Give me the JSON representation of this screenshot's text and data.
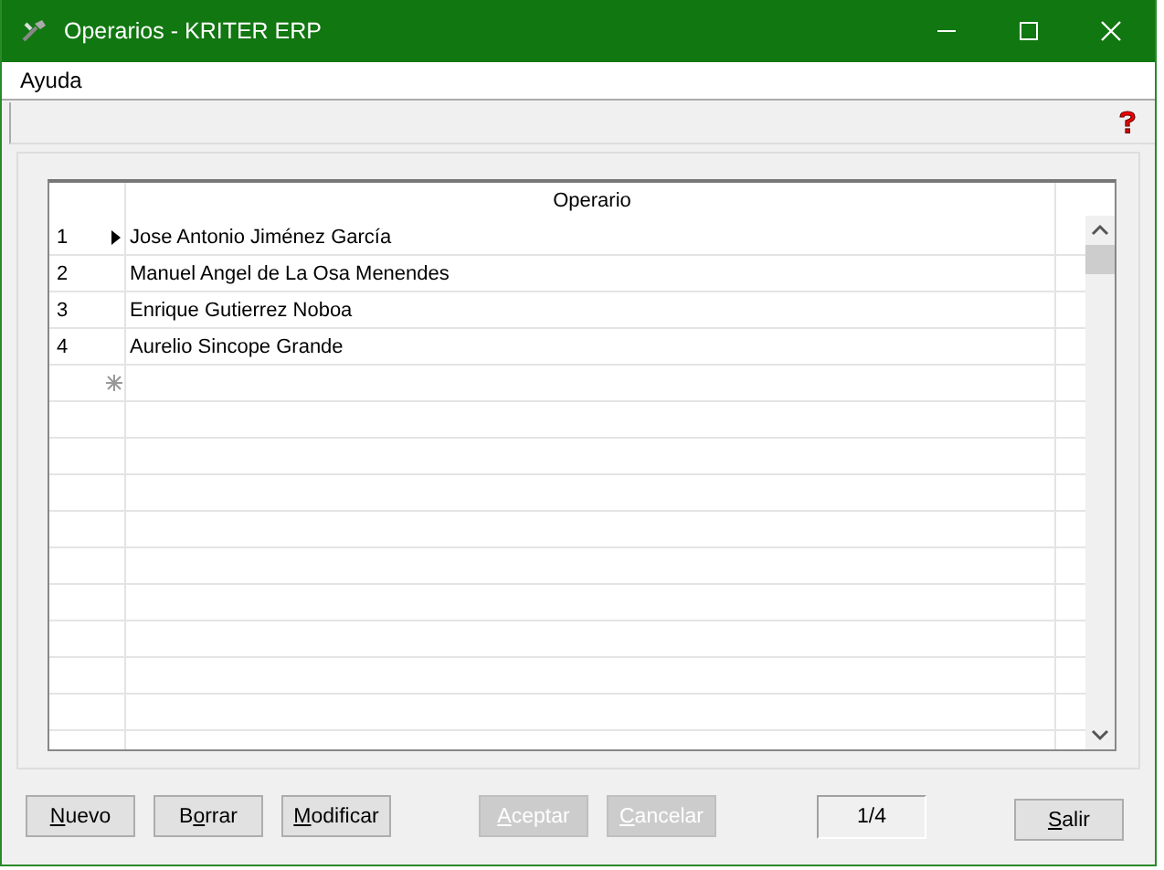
{
  "window": {
    "title": "Operarios - KRITER ERP"
  },
  "menu": [
    {
      "label": "Ayuda"
    }
  ],
  "grid": {
    "columns": [
      "Operario"
    ],
    "rows": [
      {
        "number": "1",
        "name": "Jose Antonio Jiménez García",
        "current": true
      },
      {
        "number": "2",
        "name": "Manuel Angel de La Osa Menendes",
        "current": false
      },
      {
        "number": "3",
        "name": "Enrique Gutierrez Noboa",
        "current": false
      },
      {
        "number": "4",
        "name": "Aurelio Sincope Grande",
        "current": false
      }
    ]
  },
  "buttons": [
    {
      "key": "N",
      "after": "uevo",
      "disabled": false
    },
    {
      "before": "B",
      "key": "o",
      "after": "rrar",
      "disabled": false
    },
    {
      "key": "M",
      "after": "odificar",
      "disabled": false
    },
    {
      "key": "A",
      "after": "ceptar",
      "disabled": true
    },
    {
      "key": "C",
      "after": "ancelar",
      "disabled": true
    }
  ],
  "record_counter": "1/4",
  "exit_button": {
    "key": "S",
    "after": "alir",
    "disabled": false
  }
}
